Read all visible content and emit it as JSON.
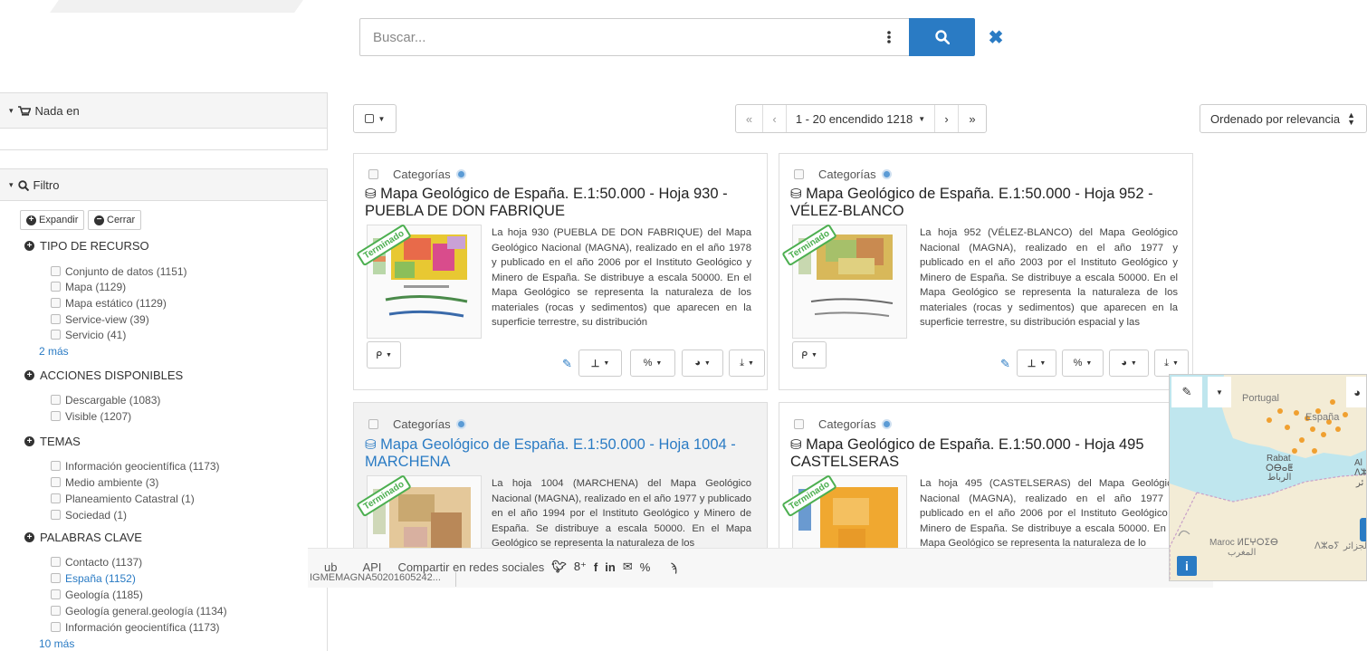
{
  "search": {
    "placeholder": "Buscar..."
  },
  "sidebar": {
    "cart_label": "Nada en",
    "filter_label": "Filtro",
    "expand_label": "Expandir",
    "close_label": "Cerrar",
    "facets": [
      {
        "title": "TIPO DE RECURSO",
        "items": [
          "Conjunto de datos (1151)",
          "Mapa (1129)",
          "Mapa estático (1129)",
          "Service-view (39)",
          "Servicio (41)"
        ],
        "more": "2 más"
      },
      {
        "title": "ACCIONES DISPONIBLES",
        "items": [
          "Descargable (1083)",
          "Visible (1207)"
        ]
      },
      {
        "title": "TEMAS",
        "items": [
          "Información geocientífica (1173)",
          "Medio ambiente (3)",
          "Planeamiento Catastral (1)",
          "Sociedad (1)"
        ]
      },
      {
        "title": "PALABRAS CLAVE",
        "items": [
          "Contacto (1137)",
          "España (1152)",
          "Geología (1185)",
          "Geología general.geología (1134)",
          "Información geocientífica (1173)"
        ],
        "more": "10 más"
      }
    ]
  },
  "toolbar": {
    "first": "«",
    "prev": "‹",
    "range": "1 - 20 encendido 1218",
    "next": "›",
    "last": "»",
    "sort": "Ordenado por relevancia"
  },
  "results": [
    {
      "category": "Categorías",
      "title": "Mapa Geológico de España. E.1:50.000 - Hoja 930 - PUEBLA DE DON FABRIQUE",
      "badge": "Terminado",
      "description": "La hoja 930 (PUEBLA DE DON FABRIQUE) del Mapa Geológico Nacional (MAGNA), realizado en el año 1978 y publicado en el año 2006 por el Instituto Geológico y Minero de España. Se distribuye a escala 50000. En el Mapa Geológico se representa la naturaleza de los materiales (rocas y sedimentos) que aparecen en la superficie terrestre, su distribución"
    },
    {
      "category": "Categorías",
      "title": "Mapa Geológico de España. E.1:50.000 - Hoja 952 - VÉLEZ-BLANCO",
      "badge": "Terminado",
      "description": "La hoja 952 (VÉLEZ-BLANCO) del Mapa Geológico Nacional (MAGNA), realizado en el año 1977 y publicado en el año 2003 por el Instituto Geológico y Minero de España. Se distribuye a escala 50000. En el Mapa Geológico se representa la naturaleza de los materiales (rocas y sedimentos) que aparecen en la superficie terrestre, su distribución espacial y las"
    },
    {
      "category": "Categorías",
      "title": "Mapa Geológico de España. E.1:50.000 - Hoja 1004 - MARCHENA",
      "badge": "Terminado",
      "description": "La hoja 1004 (MARCHENA) del Mapa Geológico Nacional (MAGNA), realizado en el año 1977 y publicado en el año 1994 por el Instituto Geológico y Minero de España. Se distribuye a escala 50000. En el Mapa Geológico se representa la naturaleza de los"
    },
    {
      "category": "Categorías",
      "title": "Mapa Geológico de España. E.1:50.000 - Hoja 495 CASTELSERAS",
      "badge": "Terminado",
      "description": "La hoja 495 (CASTELSERAS) del Mapa Geológico Nacional (MAGNA), realizado en el año 1977 y publicado en el año 2006 por el Instituto Geológico y Minero de España. Se distribuye a escala 50000. En el Mapa Geológico se representa la naturaleza de lo"
    }
  ],
  "footer": {
    "link_1": "ub",
    "api": "API",
    "share": "Compartir en redes sociales",
    "identifier": "IGMEMAGNA50201605242..."
  },
  "map": {
    "labels": {
      "portugal": "Portugal",
      "espana": "España",
      "rabat": "Rabat",
      "rabat_tif": "ⵔⴱⴰⵟ",
      "rabat_ar": "الرباط",
      "maroc": "Maroc ⵍⵎⵖⵔⵉⴱ",
      "maroc_ar": "المغرب",
      "alg": "Al",
      "alg_tif": "ⴷⵣ.",
      "alg_ar": "ئر",
      "dz": "ⴷⵣⴰⵢ",
      "dz_ar": "الجزائر"
    }
  },
  "colors": {
    "accent": "#2a7bc4",
    "badge": "#4caf50"
  }
}
